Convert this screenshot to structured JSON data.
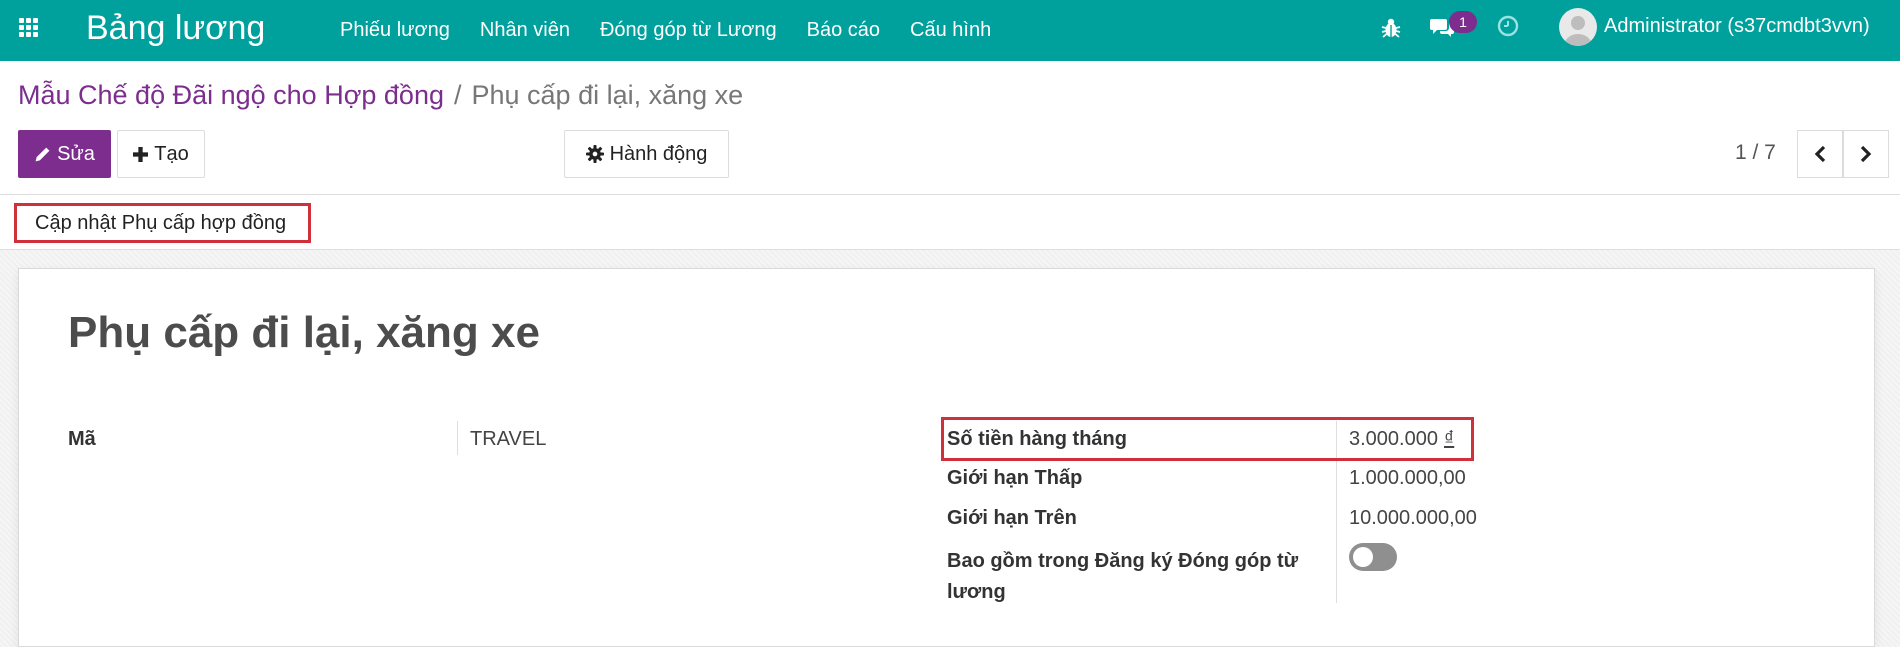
{
  "navbar": {
    "app_title": "Bảng lương",
    "menu": [
      "Phiếu lương",
      "Nhân viên",
      "Đóng góp từ Lương",
      "Báo cáo",
      "Cấu hình"
    ],
    "chat_count": "1",
    "user_name": "Administrator (s37cmdbt3vvn)",
    "accent_color": "#00a09d",
    "icons": [
      "apps-grid-icon",
      "bug-icon",
      "chat-icon",
      "clock-icon",
      "avatar"
    ]
  },
  "breadcrumb": {
    "parent": "Mẫu Chế độ Đãi ngộ cho Hợp đồng",
    "separator": "/",
    "current": "Phụ cấp đi lại, xăng xe"
  },
  "toolbar": {
    "edit_label": "Sửa",
    "create_label": "Tạo",
    "action_label": "Hành động",
    "primary_color": "#7c2d8e"
  },
  "pager": {
    "value": "1 / 7"
  },
  "statusbar": {
    "update_button_label": "Cập nhật Phụ cấp hợp đồng",
    "highlight_color": "#d0303a"
  },
  "record": {
    "title": "Phụ cấp đi lại, xăng xe",
    "fields": {
      "code_label": "Mã",
      "code_value": "TRAVEL",
      "monthly_amount_label": "Số tiền hàng tháng",
      "monthly_amount_value": "3.000.000",
      "currency_symbol": "₫",
      "lower_limit_label": "Giới hạn Thấp",
      "lower_limit_value": "1.000.000,00",
      "upper_limit_label": "Giới hạn Trên",
      "upper_limit_value": "10.000.000,00",
      "include_label": "Bao gồm trong Đăng ký Đóng góp từ lương",
      "include_value": false
    }
  }
}
